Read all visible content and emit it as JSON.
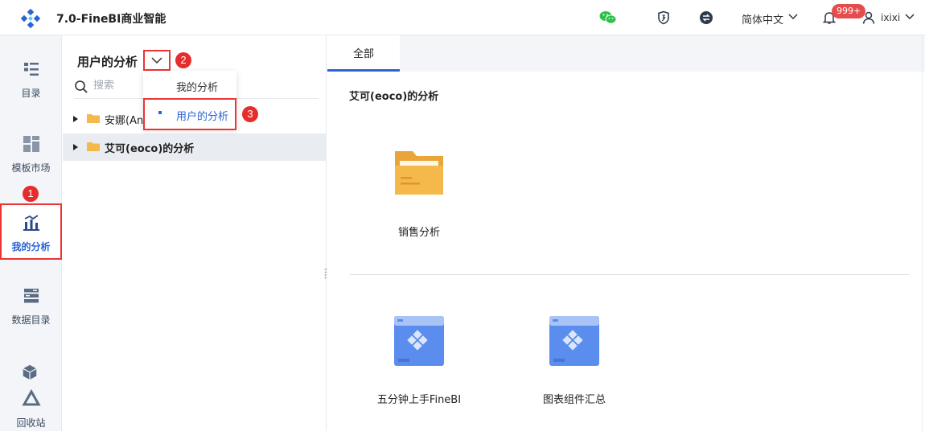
{
  "header": {
    "app_title": "7.0-FineBI商业智能",
    "language": "简体中文",
    "notification_count": "999+",
    "username": "ixixi"
  },
  "nav": {
    "items": [
      {
        "label": "目录",
        "icon": "catalog-icon"
      },
      {
        "label": "模板市场",
        "icon": "template-market-icon"
      },
      {
        "label": "我的分析",
        "icon": "my-analysis-icon"
      },
      {
        "label": "数据目录",
        "icon": "data-catalog-icon"
      },
      {
        "label": "回收站",
        "icon": "recycle-bin-icon"
      }
    ],
    "active_index": 2
  },
  "directory": {
    "title": "用户的分析",
    "search_placeholder": "搜索",
    "menu": [
      {
        "label": "我的分析"
      },
      {
        "label": "用户的分析",
        "current": true
      }
    ],
    "tree": [
      {
        "label": "安娜(An"
      },
      {
        "label": "艾可(eoco)的分析",
        "selected": true
      }
    ]
  },
  "main": {
    "tab": "全部",
    "section_title": "艾可(eoco)的分析",
    "folders": [
      {
        "label": "销售分析"
      }
    ],
    "templates": [
      {
        "label": "五分钟上手FineBI"
      },
      {
        "label": "图表组件汇总"
      }
    ]
  },
  "annotations": [
    "1",
    "2",
    "3"
  ],
  "colors": {
    "accent": "#2a64d3",
    "highlight_border": "#e33333",
    "folder": "#f5b84a",
    "template_card": "#5b8def"
  }
}
